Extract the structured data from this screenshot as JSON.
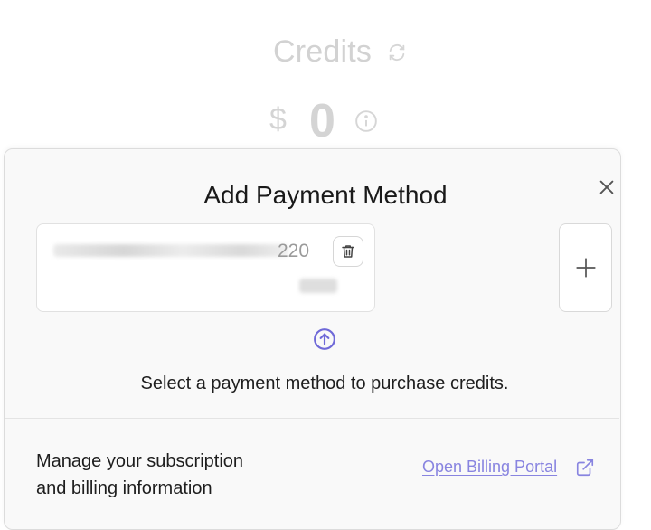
{
  "background": {
    "credits_title": "Credits",
    "currency_symbol": "$",
    "balance": "0",
    "icons": [
      "refresh-icon",
      "info-icon"
    ]
  },
  "modal": {
    "title": "Add Payment Method",
    "close_icon": "close-icon",
    "payment_card": {
      "number_suffix": "220",
      "delete_icon": "trash-icon"
    },
    "add_icon": "plus-icon",
    "upload_icon": "arrow-up-circle-icon",
    "hint": "Select a payment method to purchase credits.",
    "manage": {
      "line1": "Manage your subscription",
      "line2": "and billing information",
      "link_label": "Open Billing Portal",
      "link_icon": "external-link-icon"
    }
  },
  "colors": {
    "accent": "#6f69d8",
    "link": "#8884e0",
    "muted": "#d2d2d2"
  }
}
